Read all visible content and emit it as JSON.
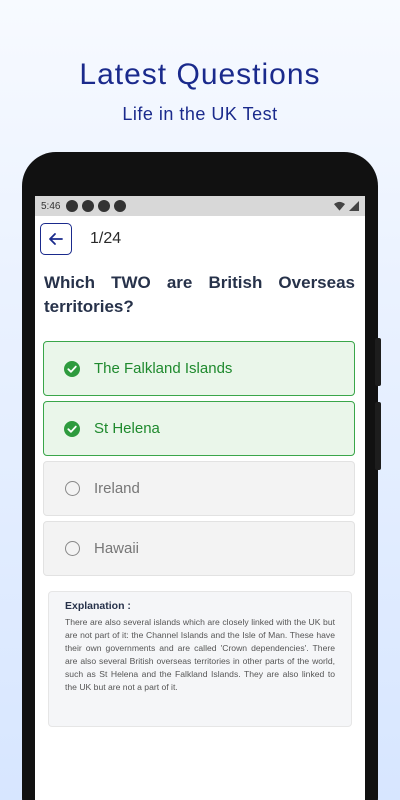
{
  "promo": {
    "title": "Latest Questions",
    "subtitle": "Life in the UK Test"
  },
  "status_bar": {
    "time": "5:46"
  },
  "header": {
    "counter": "1/24"
  },
  "question": {
    "text": "Which TWO are British Overseas territories?"
  },
  "options": [
    {
      "label": "The Falkland Islands",
      "state": "correct"
    },
    {
      "label": "St Helena",
      "state": "correct"
    },
    {
      "label": "Ireland",
      "state": "unselected"
    },
    {
      "label": "Hawaii",
      "state": "unselected"
    }
  ],
  "explanation": {
    "title": "Explanation :",
    "body": "There are also several islands which are closely linked with the UK but are not part of it: the Channel Islands and the Isle of Man. These have their own governments and are called 'Crown dependencies'. There are also several British overseas territories in other parts of the world, such as St Helena and the Falkland Islands. They are also linked to the UK but are not a part of it."
  },
  "colors": {
    "brand": "#1a2a8c",
    "correct": "#3aa64a"
  }
}
